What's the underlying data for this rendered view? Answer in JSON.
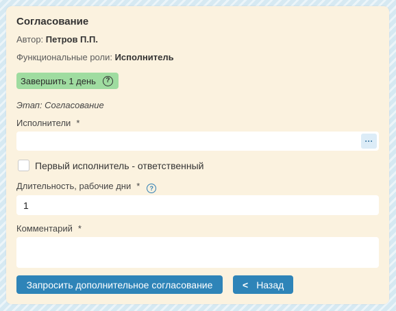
{
  "form": {
    "title": "Согласование",
    "author_label": "Автор:",
    "author_value": "Петров П.П.",
    "roles_label": "Функциональные роли:",
    "roles_value": "Исполнитель",
    "badge_text": "Завершить 1 день",
    "badge_icon": "question-icon",
    "stage_text": "Этап: Согласование",
    "performers_label": "Исполнители",
    "required_mark": "*",
    "performers_value": "",
    "picker_label": "···",
    "first_responsible_label": "Первый исполнитель - ответственный",
    "first_responsible_checked": false,
    "duration_label": "Длительность, рабочие дни",
    "duration_value": "1",
    "comment_label": "Комментарий",
    "comment_value": ""
  },
  "buttons": {
    "request_label": "Запросить дополнительное согласование",
    "back_label": "Назад",
    "back_icon": "chevron-left-icon"
  },
  "colors": {
    "accent": "#2e84b8",
    "badge_bg": "#9fdca0",
    "card_bg": "#fbf2df"
  }
}
